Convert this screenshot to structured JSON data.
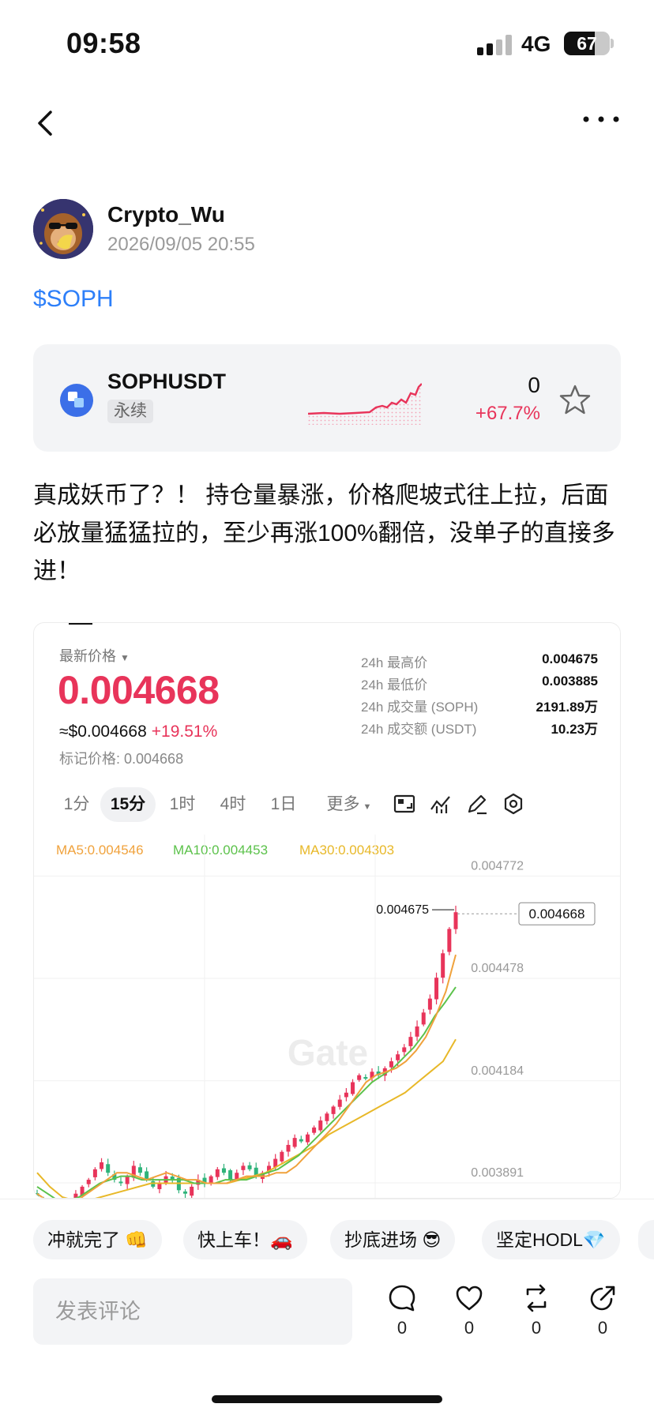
{
  "status_bar": {
    "time": "09:58",
    "network": "4G",
    "battery": "67",
    "battery_level": 0.67
  },
  "nav": {
    "back_icon": "chevron-left-icon",
    "more_icon": "more-dots-icon"
  },
  "post": {
    "author": "Crypto_Wu",
    "timestamp": "2026/09/05 20:55",
    "tag": "$SOPH",
    "body": "真成妖币了？！ 持仓量暴涨，价格爬坡式往上拉，后面必放量猛猛拉的，至少再涨100%翻倍，没单子的直接多进！"
  },
  "ticker_card": {
    "symbol": "SOPHUSDT",
    "badge": "永续",
    "price": "0",
    "change": "+67.7%",
    "change_color": "#e8345a",
    "favorite_icon": "star-icon"
  },
  "market": {
    "latest_label": "最新价格",
    "price": "0.004668",
    "usd_price": "≈$0.004668",
    "usd_change": "+19.51%",
    "mark_price": "标记价格: 0.004668",
    "stats": [
      {
        "label": "24h 最高价",
        "value": "0.004675"
      },
      {
        "label": "24h 最低价",
        "value": "0.003885"
      },
      {
        "label": "24h 成交量 (SOPH)",
        "value": "2191.89万"
      },
      {
        "label": "24h 成交额 (USDT)",
        "value": "10.23万"
      }
    ],
    "intervals": [
      "1分",
      "15分",
      "1时",
      "4时",
      "1日",
      "更多"
    ],
    "active_interval": "15分",
    "tools": [
      "screenshot-icon",
      "indicator-icon",
      "draw-icon",
      "settings-icon"
    ],
    "ma": [
      {
        "label": "MA5:0.004546",
        "color": "#f0a23c"
      },
      {
        "label": "MA10:0.004453",
        "color": "#5cc24b"
      },
      {
        "label": "MA30:0.004303",
        "color": "#e8b828"
      }
    ],
    "watermark": "Gate",
    "high_annotation": "0.004675",
    "current_price_tag": "0.004668"
  },
  "chart_data": {
    "type": "candlestick",
    "interval": "15分",
    "y_ticks": [
      "0.004772",
      "0.004478",
      "0.004184",
      "0.003891"
    ],
    "ylim": [
      0.00378,
      0.0048
    ],
    "up_color": "#e8345a",
    "down_color": "#2fb37a",
    "close_path": [
      0.00385,
      0.00383,
      0.00381,
      0.0038,
      0.00382,
      0.00384,
      0.00386,
      0.00388,
      0.0039,
      0.00393,
      0.00395,
      0.00392,
      0.0039,
      0.00389,
      0.00391,
      0.00394,
      0.00392,
      0.0039,
      0.00388,
      0.00389,
      0.00391,
      0.0039,
      0.00387,
      0.00386,
      0.00388,
      0.0039,
      0.00389,
      0.00391,
      0.00393,
      0.00392,
      0.0039,
      0.00392,
      0.00394,
      0.00393,
      0.00391,
      0.00392,
      0.00394,
      0.00396,
      0.00398,
      0.004,
      0.00402,
      0.00401,
      0.00403,
      0.00405,
      0.00407,
      0.00409,
      0.00411,
      0.00413,
      0.00415,
      0.00418,
      0.0042,
      0.00419,
      0.00421,
      0.0042,
      0.00422,
      0.00424,
      0.00426,
      0.00428,
      0.00431,
      0.00434,
      0.00438,
      0.00442,
      0.00448,
      0.00455,
      0.00462,
      0.004668
    ],
    "ma5": [
      0.00386,
      0.00384,
      0.00382,
      0.00382,
      0.00384,
      0.00386,
      0.00388,
      0.0039,
      0.00392,
      0.00392,
      0.00391,
      0.0039,
      0.00391,
      0.00392,
      0.00391,
      0.0039,
      0.0039,
      0.00389,
      0.00389,
      0.00389,
      0.0039,
      0.00391,
      0.00391,
      0.00391,
      0.00392,
      0.00392,
      0.00394,
      0.00397,
      0.004,
      0.00403,
      0.00406,
      0.0041,
      0.00414,
      0.00418,
      0.0042,
      0.00421,
      0.00422,
      0.00424,
      0.00427,
      0.00431,
      0.00437,
      0.00444,
      0.004546
    ],
    "ma10": [
      0.00388,
      0.00386,
      0.00384,
      0.00384,
      0.00385,
      0.00387,
      0.00389,
      0.0039,
      0.00391,
      0.00391,
      0.0039,
      0.0039,
      0.0039,
      0.0039,
      0.0039,
      0.00389,
      0.00389,
      0.00389,
      0.0039,
      0.0039,
      0.0039,
      0.00391,
      0.00392,
      0.00393,
      0.00395,
      0.00397,
      0.004,
      0.00403,
      0.00406,
      0.00409,
      0.00412,
      0.00415,
      0.00418,
      0.0042,
      0.00422,
      0.00425,
      0.00428,
      0.00432,
      0.00437,
      0.00441,
      0.004453
    ],
    "ma30": [
      0.00392,
      0.00388,
      0.00385,
      0.00384,
      0.00384,
      0.00385,
      0.00386,
      0.00387,
      0.00388,
      0.00389,
      0.00389,
      0.00389,
      0.00389,
      0.00389,
      0.00389,
      0.00389,
      0.0039,
      0.00391,
      0.00392,
      0.00394,
      0.00396,
      0.00398,
      0.004,
      0.00403,
      0.00405,
      0.00407,
      0.00409,
      0.00411,
      0.00413,
      0.00415,
      0.00418,
      0.00421,
      0.00424,
      0.004303
    ]
  },
  "reactions": [
    "冲就完了 👊",
    "快上车！🚗",
    "抄底进场 😎",
    "坚定HODL💎"
  ],
  "comment_placeholder": "发表评论",
  "actions": [
    {
      "icon": "comment-icon",
      "count": "0"
    },
    {
      "icon": "heart-icon",
      "count": "0"
    },
    {
      "icon": "repost-icon",
      "count": "0"
    },
    {
      "icon": "share-icon",
      "count": "0"
    }
  ]
}
